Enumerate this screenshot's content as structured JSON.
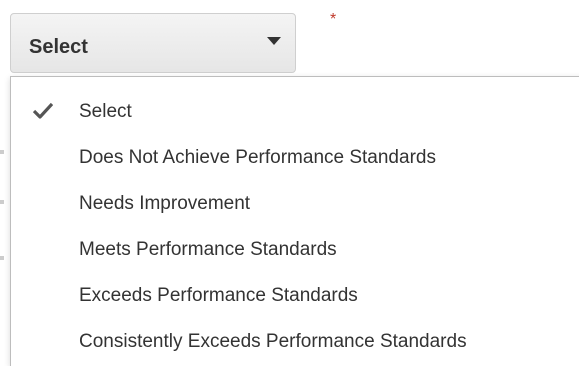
{
  "select": {
    "value": "Select",
    "required_mark": "*"
  },
  "dropdown": {
    "options": [
      {
        "label": "Select",
        "selected": true
      },
      {
        "label": "Does Not Achieve Performance Standards",
        "selected": false
      },
      {
        "label": "Needs Improvement",
        "selected": false
      },
      {
        "label": "Meets Performance Standards",
        "selected": false
      },
      {
        "label": "Exceeds Performance Standards",
        "selected": false
      },
      {
        "label": "Consistently Exceeds Performance Standards",
        "selected": false
      }
    ]
  },
  "icons": {
    "caret": "chevron-down-icon",
    "check": "check-icon"
  },
  "colors": {
    "text": "#333333",
    "required": "#c0392b",
    "menu_border": "#bdbdbd"
  }
}
